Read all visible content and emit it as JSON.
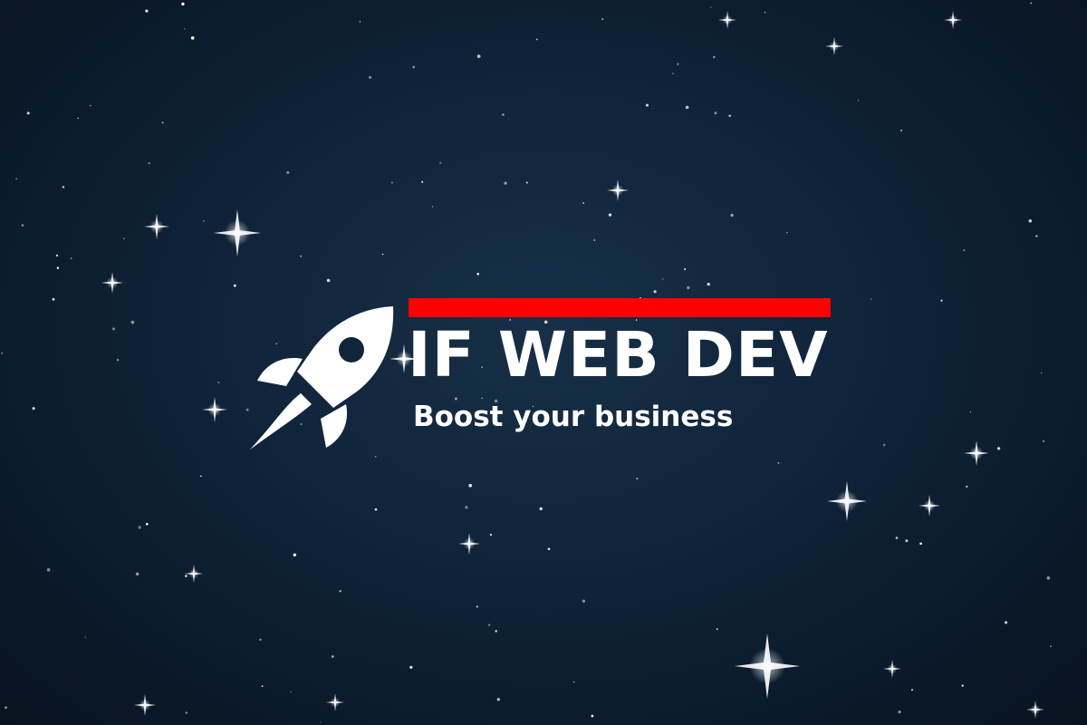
{
  "brand": {
    "name": "IF WEB DEV",
    "tagline": "Boost your business"
  },
  "icons": {
    "logo_mark": "rocket-icon",
    "background_decoration": "star-icon"
  },
  "colors": {
    "accent": "#ff0000",
    "text": "#ffffff",
    "background": "#10243a"
  }
}
